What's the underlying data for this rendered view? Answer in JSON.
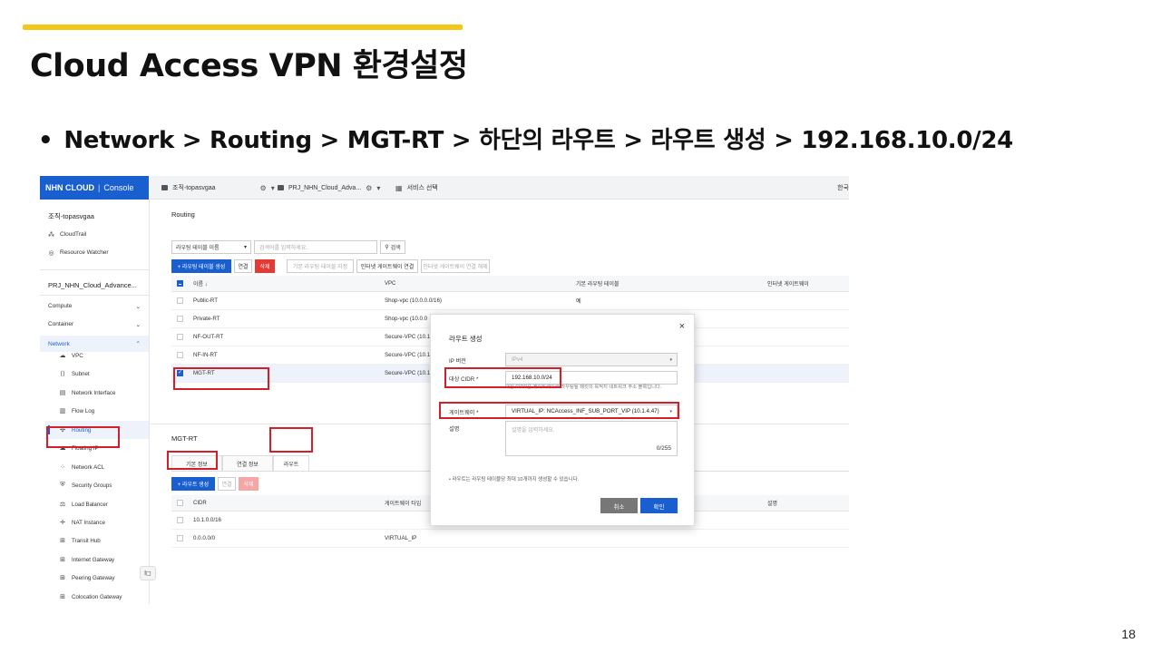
{
  "slide": {
    "title": "Cloud Access VPN 환경설정",
    "bullet_dot": "•",
    "bullet": "Network > Routing > MGT-RT > 하단의 라우트 >  라우트 생성 > 192.168.10.0/24",
    "page_number": "18",
    "accent_color": "#f5c518"
  },
  "console": {
    "logo": "NHN CLOUD",
    "logo_sep": "|",
    "logo_suffix": "Console",
    "org_tab": "조직-topasvgaa",
    "project_tab": "PRJ_NHN_Cloud_Adva...",
    "service_tab": "서비스 선택",
    "lang": "한국",
    "brand_color": "#1a5fcf"
  },
  "sidebar": {
    "org": "조직-topasvgaa",
    "org_items": [
      {
        "icon": "cloudtrail-icon",
        "label": "CloudTrail"
      },
      {
        "icon": "resource-watcher-icon",
        "label": "Resource Watcher"
      }
    ],
    "project": "PRJ_NHN_Cloud_Advance...",
    "categories": [
      {
        "label": "Compute"
      },
      {
        "label": "Container"
      },
      {
        "label": "Network"
      }
    ],
    "network_items": [
      {
        "icon": "cloud-icon",
        "label": "VPC"
      },
      {
        "icon": "subnet-icon",
        "label": "Subnet"
      },
      {
        "icon": "network-interface-icon",
        "label": "Network Interface"
      },
      {
        "icon": "flow-log-icon",
        "label": "Flow Log"
      },
      {
        "icon": "routing-icon",
        "label": "Routing"
      },
      {
        "icon": "floating-ip-icon",
        "label": "Floating IP"
      },
      {
        "icon": "network-acl-icon",
        "label": "Network ACL"
      },
      {
        "icon": "security-groups-icon",
        "label": "Security Groups"
      },
      {
        "icon": "load-balancer-icon",
        "label": "Load Balancer"
      },
      {
        "icon": "nat-instance-icon",
        "label": "NAT Instance"
      },
      {
        "icon": "transit-hub-icon",
        "label": "Transit Hub"
      },
      {
        "icon": "internet-gateway-icon",
        "label": "Internet Gateway"
      },
      {
        "icon": "peering-gateway-icon",
        "label": "Peering Gateway"
      },
      {
        "icon": "colocation-gateway-icon",
        "label": "Colocation Gateway"
      }
    ],
    "collapse": "I◻"
  },
  "routing": {
    "title": "Routing",
    "filter_select": "라우팅 테이블 이름",
    "filter_placeholder": "검색어를 입력하세요.",
    "search_btn": "검색",
    "create_btn": "+ 라우팅 테이블 생성",
    "connect_btn": "연결",
    "delete_btn": "삭제",
    "default_btn": "기본 라우팅 테이블 지정",
    "igw_connect_btn": "인터넷 게이트웨이 연결",
    "igw_disconnect_btn": "인터넷 게이트웨이 연결 해제",
    "columns": [
      "이름 ↓",
      "VPC",
      "기본 라우팅 테이블",
      "인터넷 게이트웨이"
    ],
    "rows": [
      {
        "name": "Public-RT",
        "vpc": "Shop-vpc (10.0.0.0/16)",
        "default": "예",
        "igw": "",
        "checked": false
      },
      {
        "name": "Private-RT",
        "vpc": "Shop-vpc (10.0.0",
        "default": "",
        "igw": "",
        "checked": false
      },
      {
        "name": "NF-OUT-RT",
        "vpc": "Secure-VPC (10.1.",
        "default": "",
        "igw": "",
        "checked": false
      },
      {
        "name": "NF-IN-RT",
        "vpc": "Secure-VPC (10.1.",
        "default": "",
        "igw": "",
        "checked": false
      },
      {
        "name": "MGT-RT",
        "vpc": "Secure-VPC (10.1.",
        "default": "",
        "igw": "",
        "checked": true
      }
    ]
  },
  "detail": {
    "title": "MGT-RT",
    "tabs": [
      "기본 정보",
      "연결 정보",
      "라우트"
    ],
    "create_route_btn": "+ 라우트 생성",
    "connect_btn": "연결",
    "delete_btn": "삭제",
    "columns": [
      "CIDR",
      "게이트웨이 타입",
      "설명"
    ],
    "rows": [
      {
        "cidr": "10.1.0.0/16",
        "type": ""
      },
      {
        "cidr": "0.0.0.0/0",
        "type": "VIRTUAL_IP"
      }
    ]
  },
  "modal": {
    "title": "라우트 생성",
    "close": "×",
    "ip_version_label": "IP 버전",
    "ip_version_value": "IPv4",
    "cidr_label": "대상 CIDR *",
    "cidr_value": "192.168.10.0/24",
    "cidr_help": "대상 CIDR은 게이트웨이로 라우팅될 패킷의 목적지 네트워크 주소 블록입니다.",
    "gateway_label": "게이트웨이 *",
    "gateway_value": "VIRTUAL_IP: NCAccess_INF_SUB_PORT_VIP (10.1.4.47)",
    "desc_label": "설명",
    "desc_placeholder": "설명을 입력하세요.",
    "desc_count": "0/255",
    "note": "• 라우트는 라우팅 테이블당 최대 10개까지 생성할 수 있습니다.",
    "cancel": "취소",
    "ok": "확인"
  }
}
